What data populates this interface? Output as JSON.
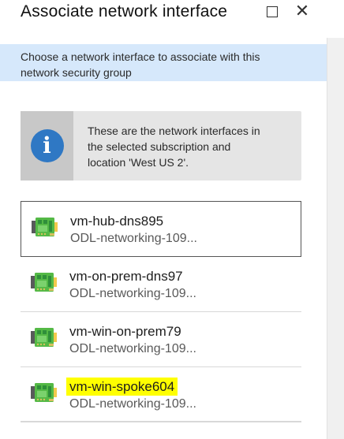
{
  "window": {
    "title": "Associate network interface"
  },
  "description": {
    "text_line_1": "Choose a network interface to associate with this",
    "text_line_2": "network security group"
  },
  "info": {
    "text_line_1": "These are the network interfaces in",
    "text_line_2": "the selected subscription and",
    "text_line_3": "location 'West US 2'."
  },
  "network_interfaces": [
    {
      "name": "vm-hub-dns895",
      "resource_group": "ODL-networking-109..."
    },
    {
      "name": "vm-on-prem-dns97",
      "resource_group": "ODL-networking-109..."
    },
    {
      "name": "vm-win-on-prem79",
      "resource_group": "ODL-networking-109..."
    },
    {
      "name": "vm-win-spoke604",
      "resource_group": "ODL-networking-109..."
    }
  ],
  "icons": {
    "maximize": "maximize-icon",
    "close": "close-icon",
    "info": "info-icon",
    "network_interface": "network-interface-icon"
  },
  "colors": {
    "description_background": "#d6e8fb",
    "info_circle": "#2f78c4",
    "highlight": "#ffff00",
    "nic_green": "#54b946"
  }
}
